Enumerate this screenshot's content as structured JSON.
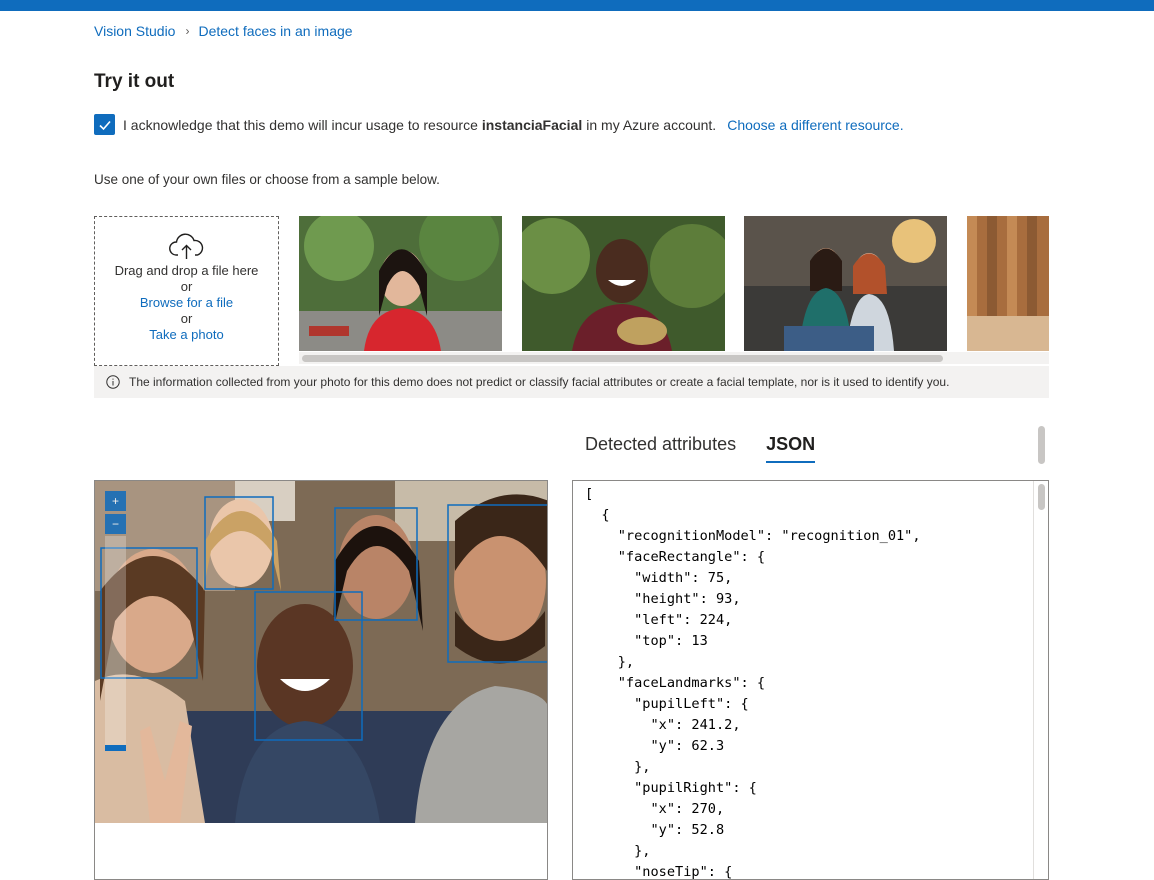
{
  "breadcrumb": {
    "root": "Vision Studio",
    "current": "Detect faces in an image"
  },
  "page_title": "Try it out",
  "acknowledge": {
    "checked": true,
    "text_before": "I acknowledge that this demo will incur usage to resource",
    "resource": "instanciaFacial",
    "text_after": "in my Azure account.",
    "change_link": "Choose a different resource."
  },
  "instruction": "Use one of your own files or choose from a sample below.",
  "dropzone": {
    "drag_text": "Drag and drop a file here",
    "or1": "or",
    "browse_link": "Browse for a file",
    "or2": "or",
    "photo_link": "Take a photo"
  },
  "notice": "The information collected from your photo for this demo does not predict or classify facial attributes or create a facial template, nor is it used to identify you.",
  "tabs": {
    "detected": "Detected attributes",
    "json": "JSON",
    "active": "JSON"
  },
  "zoom": {
    "in_label": "+",
    "out_label": "−"
  },
  "json_output": "[\n  {\n    \"recognitionModel\": \"recognition_01\",\n    \"faceRectangle\": {\n      \"width\": 75,\n      \"height\": 93,\n      \"left\": 224,\n      \"top\": 13\n    },\n    \"faceLandmarks\": {\n      \"pupilLeft\": {\n        \"x\": 241.2,\n        \"y\": 62.3\n      },\n      \"pupilRight\": {\n        \"x\": 270,\n        \"y\": 52.8\n      },\n      \"noseTip\": {",
  "colors": {
    "accent": "#0f6cbd",
    "notice_bg": "#f3f2f1",
    "text": "#323130"
  }
}
